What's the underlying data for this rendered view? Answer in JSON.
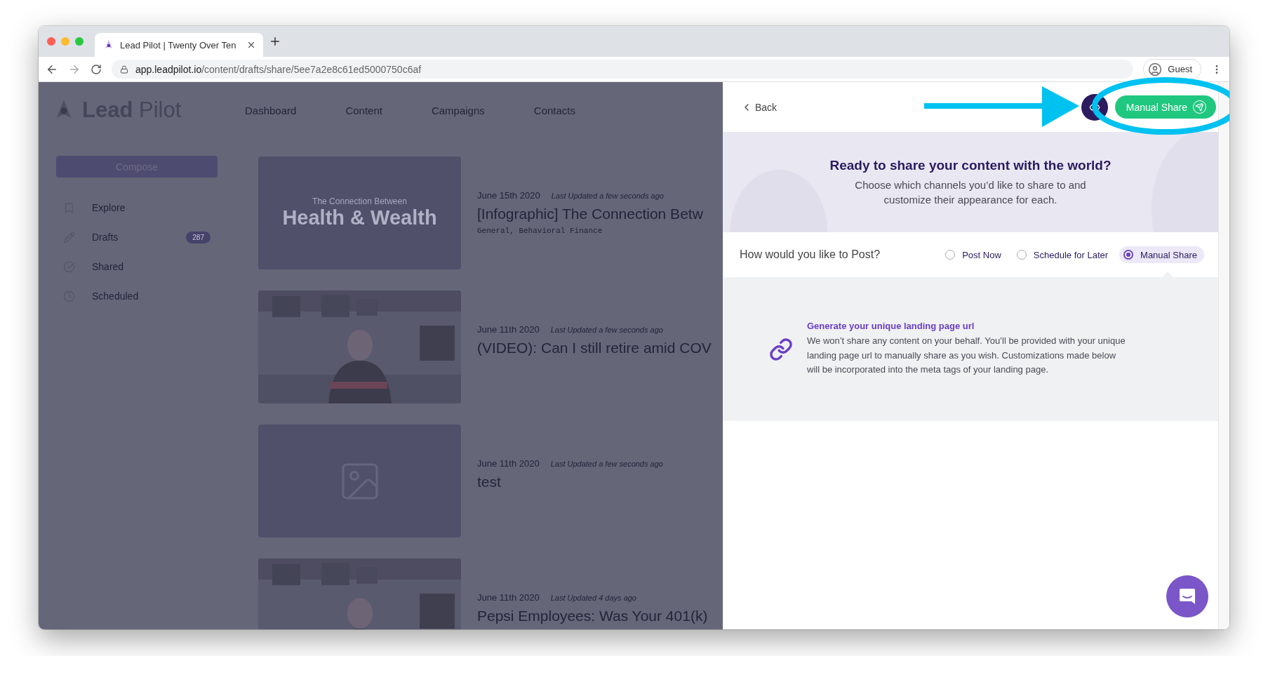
{
  "browser": {
    "tab_title": "Lead Pilot | Twenty Over Ten",
    "url_host": "app.leadpilot.io",
    "url_path": "/content/drafts/share/5ee7a2e8c61ed5000750c6af",
    "profile": "Guest"
  },
  "app": {
    "logo": "**Lead** Pilot",
    "nav": [
      "Dashboard",
      "Content",
      "Campaigns",
      "Contacts"
    ],
    "compose": "Compose",
    "sidebar": [
      {
        "label": "Explore",
        "kind": "explore"
      },
      {
        "label": "Drafts",
        "kind": "drafts",
        "badge": "287"
      },
      {
        "label": "Shared",
        "kind": "shared"
      },
      {
        "label": "Scheduled",
        "kind": "scheduled"
      }
    ],
    "drafts": [
      {
        "kind": "infographic",
        "thumb_caption": "The Connection Between",
        "thumb_title": "Health & Wealth",
        "date": "June 15th 2020",
        "updated": "Last Updated a few seconds ago",
        "title": "[Infographic] The Connection Betw",
        "tags": "General, Behavioral Finance"
      },
      {
        "kind": "picture",
        "date": "June 11th 2020",
        "updated": "Last Updated a few seconds ago",
        "title": "(VIDEO): Can I still retire amid COV"
      },
      {
        "kind": "placeholder",
        "date": "June 11th 2020",
        "updated": "Last Updated a few seconds ago",
        "title": "test"
      },
      {
        "kind": "picture",
        "date": "June 11th 2020",
        "updated": "Last Updated 4 days ago",
        "title": "Pepsi Employees: Was Your 401(k)"
      }
    ]
  },
  "panel": {
    "back": "Back",
    "action": "Manual Share",
    "hero": {
      "heading": "Ready to share your content with the world?",
      "text": "Choose which channels you’d like to share to and customize their appearance for each."
    },
    "question": "How would you like to Post?",
    "options": [
      {
        "label": "Post Now",
        "selected": false
      },
      {
        "label": "Schedule for Later",
        "selected": false
      },
      {
        "label": "Manual Share",
        "selected": true
      }
    ],
    "info": {
      "heading": "Generate your unique landing page url",
      "text": "We won’t share any content on your behalf.  You’ll be provided with your unique landing page url to manually share as you wish.  Customizations made below will be incorporated into the meta tags of your landing page."
    }
  }
}
